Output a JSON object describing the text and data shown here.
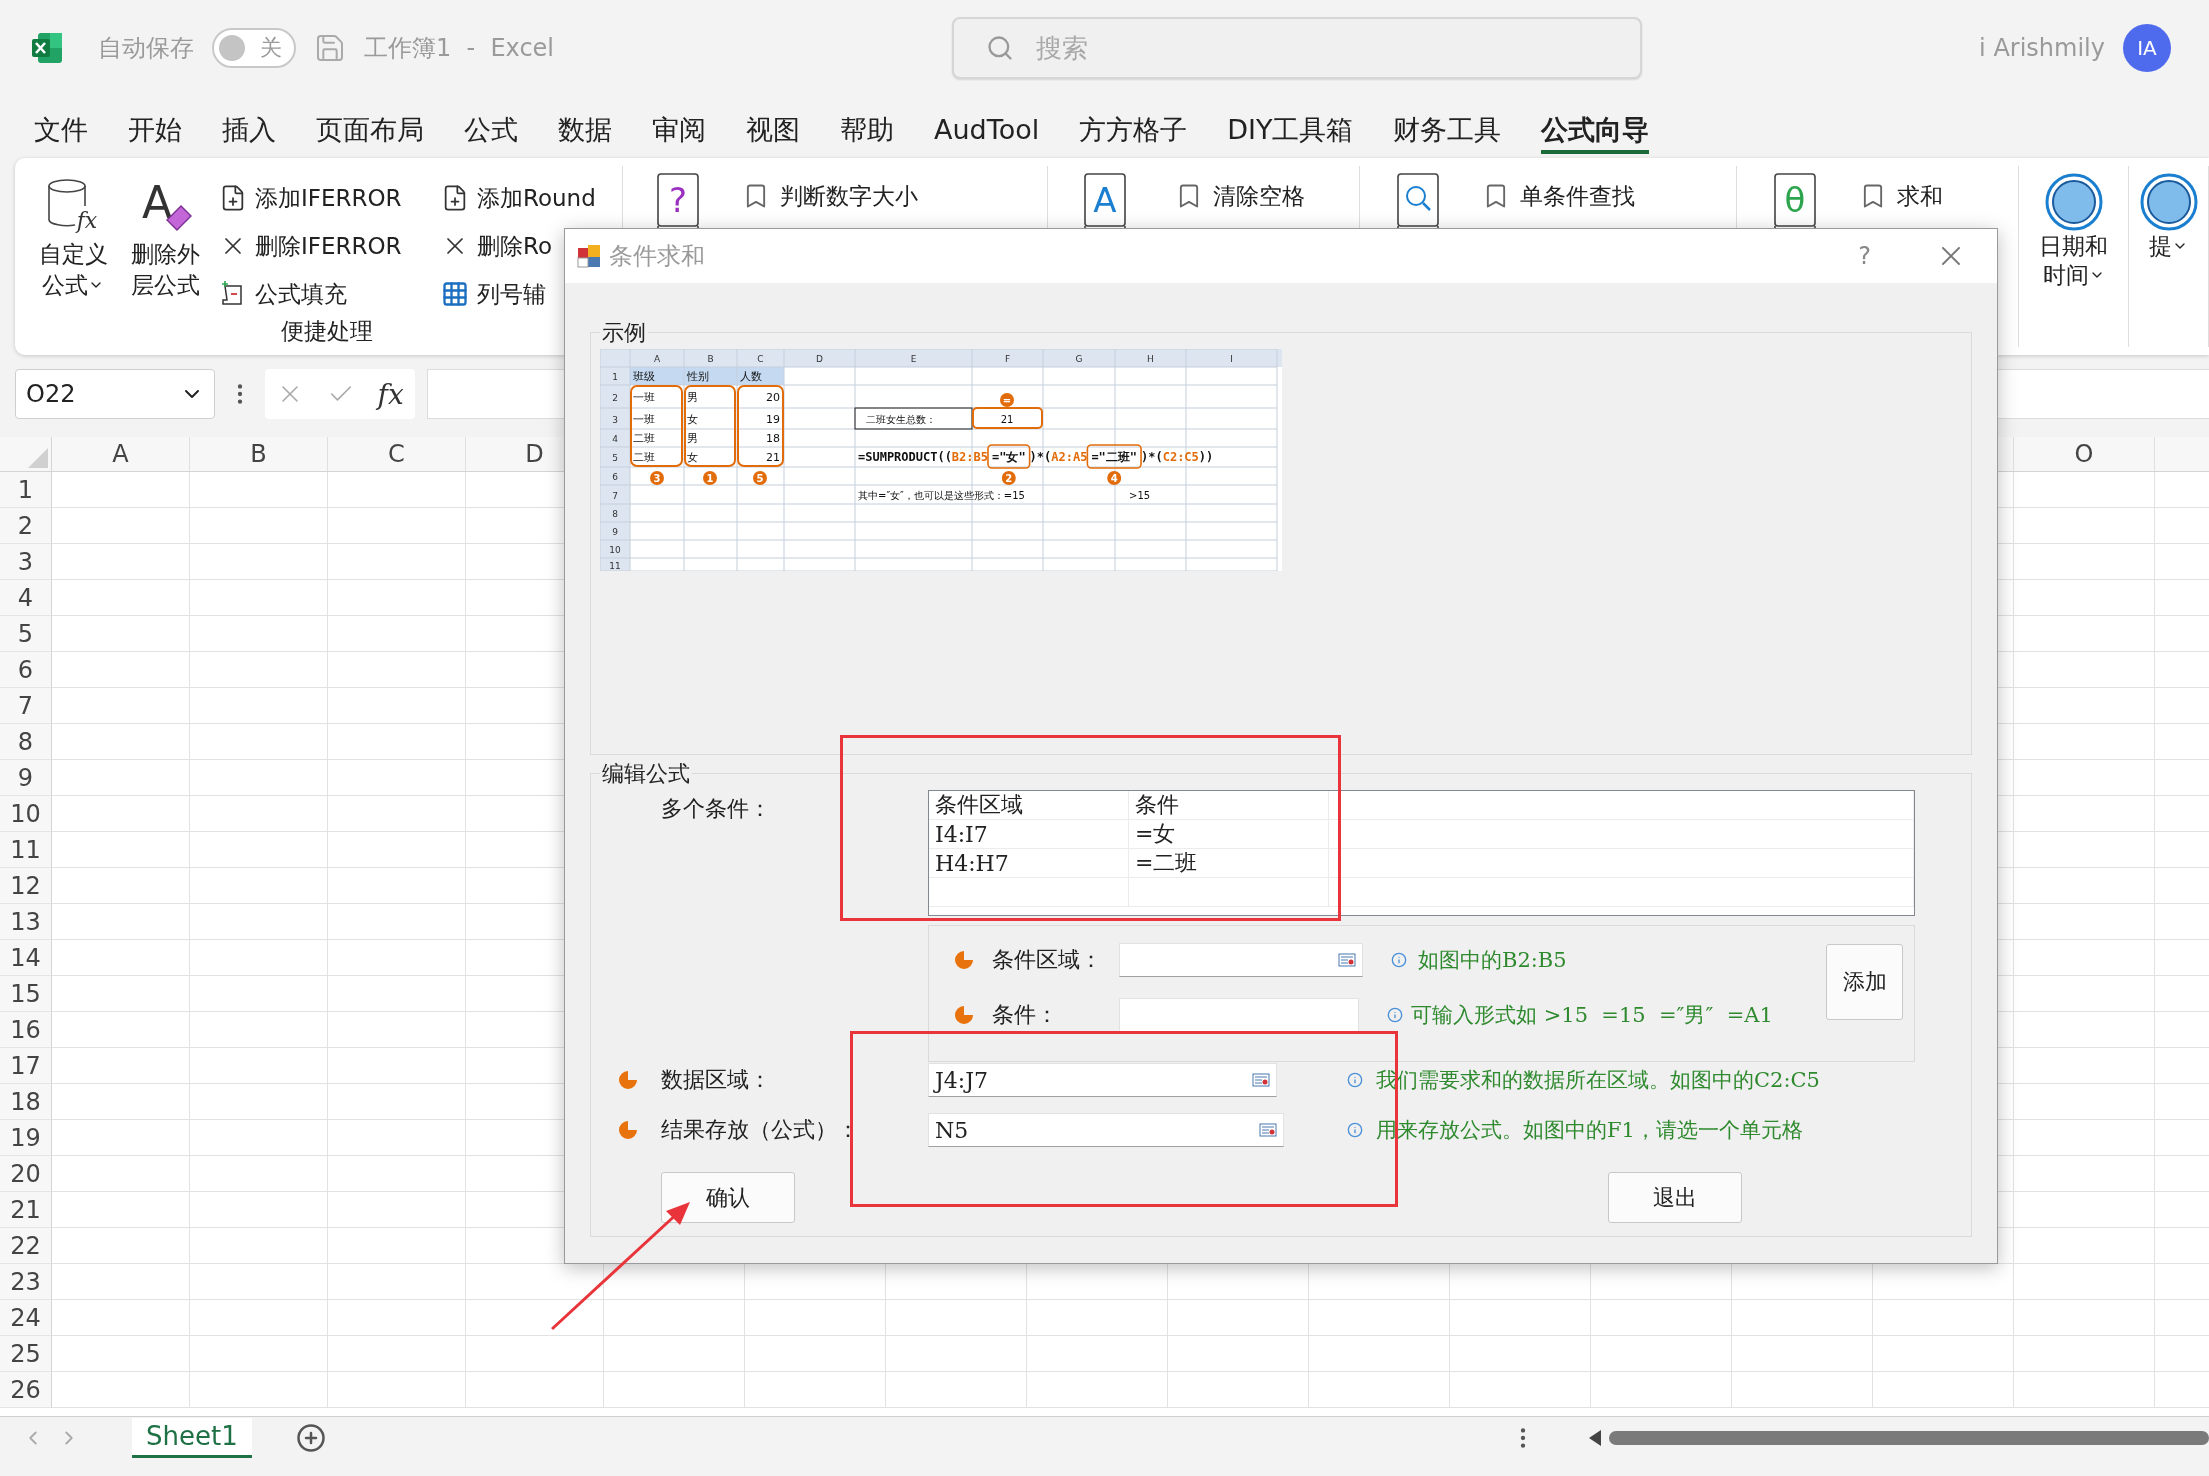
{
  "titlebar": {
    "autosave_label": "自动保存",
    "autosave": {
      "on": false,
      "label": "关"
    },
    "document_title": "工作簿1  -  Excel",
    "search_placeholder": "搜索",
    "user_name": "i Arishmily",
    "avatar_initials": "IA"
  },
  "menu_tabs": [
    {
      "label": "文件",
      "selected": false
    },
    {
      "label": "开始",
      "selected": false
    },
    {
      "label": "插入",
      "selected": false
    },
    {
      "label": "页面布局",
      "selected": false
    },
    {
      "label": "公式",
      "selected": false
    },
    {
      "label": "数据",
      "selected": false
    },
    {
      "label": "审阅",
      "selected": false
    },
    {
      "label": "视图",
      "selected": false
    },
    {
      "label": "帮助",
      "selected": false
    },
    {
      "label": "AudTool",
      "selected": false
    },
    {
      "label": "方方格子",
      "selected": false
    },
    {
      "label": "DIY工具箱",
      "selected": false
    },
    {
      "label": "财务工具",
      "selected": false
    },
    {
      "label": "公式向导",
      "selected": true
    }
  ],
  "ribbon": {
    "large_buttons": [
      {
        "kind": "cylinder",
        "glyph": "fx",
        "lines": [
          "自定义",
          "公式"
        ],
        "dropdown": true
      },
      {
        "kind": "eraser",
        "glyph": "A",
        "lines": [
          "删除外",
          "层公式"
        ],
        "dropdown": false
      }
    ],
    "small_columns": [
      [
        {
          "kind": "add",
          "label": "添加IFERROR"
        },
        {
          "kind": "delete",
          "label": "删除IFERROR"
        },
        {
          "kind": "fill",
          "label": "公式填充"
        }
      ],
      [
        {
          "kind": "add",
          "label": "添加Round"
        },
        {
          "kind": "delete",
          "label": "删除Ro"
        },
        {
          "kind": "grid",
          "label": "列号辅"
        }
      ]
    ],
    "group_label": "便捷处理",
    "book_groups": [
      {
        "kind": "question",
        "glyph": "?",
        "item": "判断数字大小"
      },
      {
        "kind": "letter",
        "glyph": "A",
        "item": "清除空格"
      },
      {
        "kind": "search",
        "item": "单条件查找"
      },
      {
        "kind": "theta",
        "glyph": "θ",
        "item": "求和"
      }
    ],
    "round_buttons": [
      {
        "lines": [
          "日期和",
          "时间"
        ]
      },
      {
        "lines": [
          "提"
        ]
      }
    ]
  },
  "formula_bar": {
    "name_box": "O22",
    "function_glyph": "fx"
  },
  "sheet": {
    "columns_left": [
      "A",
      "B",
      "C",
      "D"
    ],
    "columns_right": [
      "O"
    ],
    "rows": [
      "1",
      "2",
      "3",
      "4",
      "5",
      "6",
      "7",
      "8",
      "9",
      "10",
      "11",
      "12",
      "13",
      "14",
      "15",
      "16",
      "17",
      "18",
      "19",
      "20",
      "21",
      "22",
      "23",
      "24",
      "25",
      "26"
    ]
  },
  "sheet_tabs": [
    {
      "label": "Sheet1",
      "selected": true
    }
  ],
  "dialog": {
    "title": "条件求和",
    "help": "?",
    "example": {
      "legend": "示例",
      "column_headers": [
        "A",
        "B",
        "C",
        "D",
        "E",
        "F",
        "G",
        "H",
        "I"
      ],
      "row_numbers": [
        "1",
        "2",
        "3",
        "4",
        "5",
        "6",
        "7",
        "8",
        "9",
        "10",
        "11"
      ],
      "table": [
        [
          "班级",
          "性别",
          "人数"
        ],
        [
          "一班",
          "男",
          "20"
        ],
        [
          "一班",
          "女",
          "19"
        ],
        [
          "二班",
          "男",
          "18"
        ],
        [
          "二班",
          "女",
          "21"
        ]
      ],
      "column_markers": [
        "3",
        "1",
        "5"
      ],
      "total_label": "二班女生总数：",
      "total_value": "21",
      "total_marker": "=",
      "formula": [
        {
          "text": "=SUMPRODUCT((",
          "kind": "plain",
          "boxed": false
        },
        {
          "text": "B2:B5",
          "kind": "range",
          "boxed": false
        },
        {
          "text": "=\"女\"",
          "kind": "plain",
          "boxed": true
        },
        {
          "text": ")*(",
          "kind": "plain",
          "boxed": false
        },
        {
          "text": "A2:A5",
          "kind": "range",
          "boxed": false
        },
        {
          "text": "=\"二班\"",
          "kind": "plain",
          "boxed": true
        },
        {
          "text": ")*(",
          "kind": "plain",
          "boxed": false
        },
        {
          "text": "C2:C5",
          "kind": "range",
          "boxed": false
        },
        {
          "text": "))",
          "kind": "plain",
          "boxed": false
        }
      ],
      "formula_markers": [
        "2",
        "4"
      ],
      "note": "其中=″女″，也可以是这些形式：=15",
      "note_extra": ">15"
    },
    "edit": {
      "legend": "编辑公式",
      "conditions_label": "多个条件：",
      "list_headers": [
        "条件区域",
        "条件"
      ],
      "list_rows": [
        [
          "I4:I7",
          "=女"
        ],
        [
          "H4:H7",
          "=二班"
        ]
      ],
      "range_label": "条件区域：",
      "range_hint": "如图中的B2:B5",
      "condition_label": "条件：",
      "condition_hint": "可输入形式如 >15  =15  =″男″  =A1",
      "add_button": "添加",
      "data_label": "数据区域：",
      "data_value": "J4:J7",
      "data_hint": "我们需要求和的数据所在区域。如图中的C2:C5",
      "result_label": "结果存放（公式）：",
      "result_value": "N5",
      "result_hint": "用来存放公式。如图中的F1，请选一个单元格",
      "confirm": "确认",
      "exit": "退出"
    }
  }
}
